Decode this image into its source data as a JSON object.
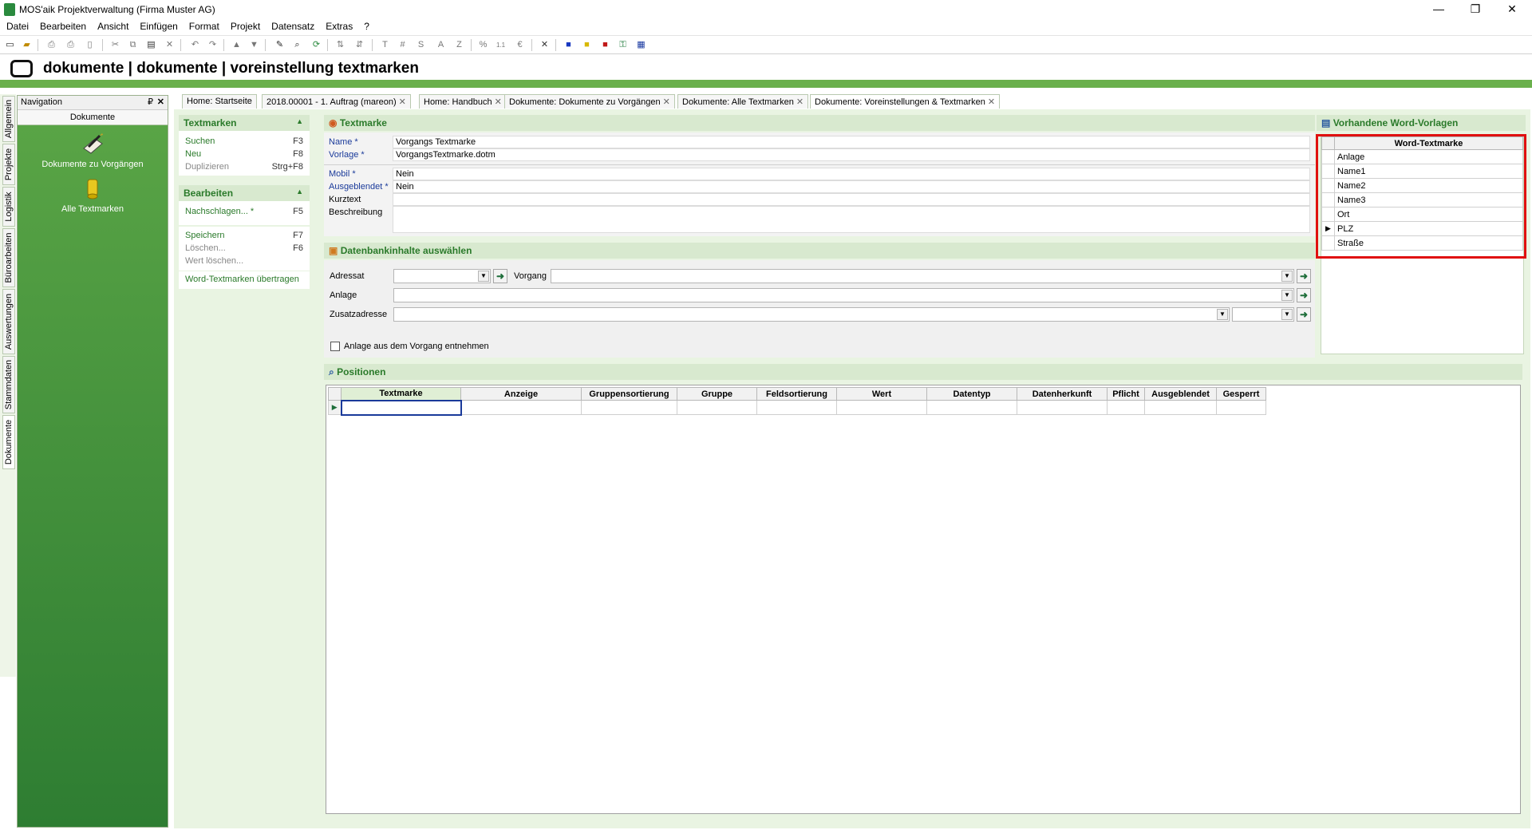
{
  "window": {
    "title": "MOS'aik Projektverwaltung (Firma Muster AG)",
    "minimize": "—",
    "restore": "❐",
    "close": "✕"
  },
  "menu": [
    "Datei",
    "Bearbeiten",
    "Ansicht",
    "Einfügen",
    "Format",
    "Projekt",
    "Datensatz",
    "Extras",
    "?"
  ],
  "toolbar": {
    "text_buttons": [
      "T",
      "#",
      "S",
      "A",
      "Z",
      "%",
      "1.1",
      "€"
    ]
  },
  "header": {
    "title": "dokumente | dokumente | voreinstellung textmarken"
  },
  "side_tabs": [
    "Allgemein",
    "Projekte",
    "Logistik",
    "Büroarbeiten",
    "Auswertungen",
    "Stammdaten",
    "Dokumente"
  ],
  "navigation": {
    "title": "Navigation",
    "pin": "₽",
    "close": "✕",
    "section": "Dokumente",
    "items": [
      "Dokumente zu Vorgängen",
      "Alle Textmarken"
    ]
  },
  "tabs": [
    {
      "label": "Home: Startseite"
    },
    {
      "label": "2018.00001 - 1. Auftrag (mareon)"
    },
    {
      "label": "Home: Handbuch"
    },
    {
      "label": "Dokumente: Dokumente zu Vorgängen"
    },
    {
      "label": "Dokumente: Alle Textmarken"
    },
    {
      "label": "Dokumente: Voreinstellungen & Textmarken"
    }
  ],
  "actions": {
    "textmarken": {
      "title": "Textmarken",
      "items": [
        {
          "label": "Suchen",
          "key": "F3"
        },
        {
          "label": "Neu",
          "key": "F8"
        },
        {
          "label": "Duplizieren",
          "key": "Strg+F8"
        }
      ]
    },
    "bearbeiten": {
      "title": "Bearbeiten",
      "items": [
        {
          "label": "Nachschlagen... *",
          "key": "F5"
        },
        {
          "label": "Speichern",
          "key": "F7"
        },
        {
          "label": "Löschen...",
          "key": "F6"
        },
        {
          "label": "Wert löschen...",
          "key": ""
        },
        {
          "label": "Word-Textmarken übertragen",
          "key": ""
        }
      ]
    }
  },
  "textmarke": {
    "title": "Textmarke",
    "fields": {
      "name": {
        "label": "Name *",
        "value": "Vorgangs Textmarke"
      },
      "vorlage": {
        "label": "Vorlage *",
        "value": "VorgangsTextmarke.dotm"
      },
      "mobil": {
        "label": "Mobil *",
        "value": "Nein"
      },
      "ausgeblendet": {
        "label": "Ausgeblendet *",
        "value": "Nein"
      },
      "kurztext": {
        "label": "Kurztext",
        "value": ""
      },
      "beschreibung": {
        "label": "Beschreibung",
        "value": ""
      }
    }
  },
  "datenbank": {
    "title": "Datenbankinhalte auswählen",
    "adressat": "Adressat",
    "vorgang": "Vorgang",
    "anlage": "Anlage",
    "zusatzadresse": "Zusatzadresse",
    "checkbox_label": "Anlage aus dem Vorgang entnehmen",
    "checkbox_checked": false
  },
  "word_vorlagen": {
    "title": "Vorhandene Word-Vorlagen",
    "column": "Word-Textmarke",
    "rows": [
      "Anlage",
      "Name1",
      "Name2",
      "Name3",
      "Ort",
      "PLZ",
      "Straße"
    ],
    "selected": "PLZ"
  },
  "positionen": {
    "title": "Positionen",
    "columns": [
      "Textmarke",
      "Anzeige",
      "Gruppensortierung",
      "Gruppe",
      "Feldsortierung",
      "Wert",
      "Datentyp",
      "Datenherkunft",
      "Pflicht",
      "Ausgeblendet",
      "Gesperrt"
    ]
  },
  "colors": {
    "accent_green": "#2a7a2a",
    "header_bar": "#6ab04c",
    "highlight_red": "#e01010"
  }
}
